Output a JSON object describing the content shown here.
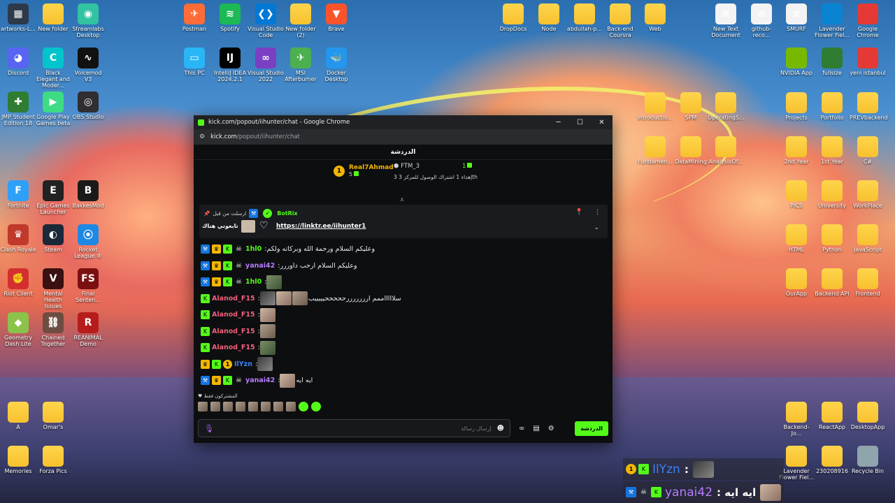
{
  "desktop": {
    "left_icons": [
      {
        "label": "artworks-L...",
        "color": "#2d3a4a",
        "glyph": "▦"
      },
      {
        "label": "New folder",
        "color": "folder",
        "glyph": ""
      },
      {
        "label": "Streamlabs Desktop",
        "color": "#31c3a2",
        "glyph": "◉"
      },
      {
        "label": "Discord",
        "color": "#5865f2",
        "glyph": "◕"
      },
      {
        "label": "Black Elegant and Moder...",
        "color": "#00c4cc",
        "glyph": "C"
      },
      {
        "label": "Voicemod V3",
        "color": "#111111",
        "glyph": "∿"
      },
      {
        "label": "JMP Student Edition 18",
        "color": "#2e7d32",
        "glyph": "✚"
      },
      {
        "label": "Google Play Games beta",
        "color": "#3ddc84",
        "glyph": "▶"
      },
      {
        "label": "OBS Studio",
        "color": "#302e31",
        "glyph": "◎"
      },
      {
        "label": "Fortnite",
        "color": "#2ea0f8",
        "glyph": "F"
      },
      {
        "label": "Epic Games Launcher",
        "color": "#222222",
        "glyph": "E"
      },
      {
        "label": "BakkesMod",
        "color": "#1a1a1a",
        "glyph": "B"
      },
      {
        "label": "Clash Royale",
        "color": "#c0392b",
        "glyph": "♛"
      },
      {
        "label": "Steam",
        "color": "#1b2838",
        "glyph": "◐"
      },
      {
        "label": "Rocket League ®",
        "color": "#1e88e5",
        "glyph": "⦿"
      },
      {
        "label": "Riot Client",
        "color": "#d32f2f",
        "glyph": "✊"
      },
      {
        "label": "Mental Health Issues",
        "color": "#3a1010",
        "glyph": "V"
      },
      {
        "label": "Final Senten...",
        "color": "#7a1010",
        "glyph": "FS"
      },
      {
        "label": "Geometry Dash Lite",
        "color": "#8bc34a",
        "glyph": "◆"
      },
      {
        "label": "Chained Together",
        "color": "#6d4c41",
        "glyph": "⛓"
      },
      {
        "label": "REANIMAL Demo",
        "color": "#b71c1c",
        "glyph": "R"
      },
      {
        "label": "A",
        "color": "folder",
        "glyph": ""
      },
      {
        "label": "Omar's",
        "color": "folder",
        "glyph": ""
      },
      {
        "label": "Memories",
        "color": "folder",
        "glyph": ""
      },
      {
        "label": "Forza Pics",
        "color": "folder",
        "glyph": ""
      }
    ],
    "top_icons": [
      {
        "label": "Postman",
        "color": "#ff6c37",
        "glyph": "✈"
      },
      {
        "label": "Spotify",
        "color": "#1db954",
        "glyph": "≋"
      },
      {
        "label": "Visual Studio Code",
        "color": "#0078d4",
        "glyph": "❮❯"
      },
      {
        "label": "New folder (2)",
        "color": "folder",
        "glyph": ""
      },
      {
        "label": "Brave",
        "color": "#fb542b",
        "glyph": "▼"
      },
      {
        "label": "This PC",
        "color": "#29b6f6",
        "glyph": "▭"
      },
      {
        "label": "IntelliJ IDEA 2024.2.1",
        "color": "#000000",
        "glyph": "IJ"
      },
      {
        "label": "Visual Studio 2022",
        "color": "#7b3fc4",
        "glyph": "∞"
      },
      {
        "label": "MSI Afterburner",
        "color": "#4caf50",
        "glyph": "✈"
      },
      {
        "label": "Docker Desktop",
        "color": "#2496ed",
        "glyph": "🐳"
      }
    ],
    "right_icons": [
      {
        "label": "DropDocs",
        "color": "folder"
      },
      {
        "label": "Node",
        "color": "folder"
      },
      {
        "label": "abdullah-p...",
        "color": "folder"
      },
      {
        "label": "Back-end Coursra",
        "color": "folder"
      },
      {
        "label": "Web",
        "color": "folder"
      },
      {
        "label": "New Text Document",
        "color": "doc"
      },
      {
        "label": "github-reco...",
        "color": "doc"
      },
      {
        "label": "SMURF",
        "color": "doc"
      },
      {
        "label": "Lavender Flower Fiel...",
        "color": "#0a84d0"
      },
      {
        "label": "Google Chrome",
        "color": "#e53935"
      },
      {
        "label": "NVIDIA App",
        "color": "#76b900"
      },
      {
        "label": "fullsize",
        "color": "#2e7d32"
      },
      {
        "label": "yeni istanbul",
        "color": "#e53935"
      },
      {
        "label": "Introductio...",
        "color": "folder"
      },
      {
        "label": "SPM",
        "color": "folder"
      },
      {
        "label": "OperatingS...",
        "color": "folder"
      },
      {
        "label": "Projects",
        "color": "folder"
      },
      {
        "label": "Portfolio",
        "color": "folder"
      },
      {
        "label": "PREVbackend",
        "color": "folder"
      },
      {
        "label": "Fundamen...",
        "color": "folder"
      },
      {
        "label": "DataMining",
        "color": "folder"
      },
      {
        "label": "AnalysisOf...",
        "color": "folder"
      },
      {
        "label": "2nd Year",
        "color": "folder"
      },
      {
        "label": "1st Year",
        "color": "folder"
      },
      {
        "label": "C#",
        "color": "folder"
      },
      {
        "label": "PICS",
        "color": "folder"
      },
      {
        "label": "University",
        "color": "folder"
      },
      {
        "label": "WorkPlace",
        "color": "folder"
      },
      {
        "label": "HTML",
        "color": "folder"
      },
      {
        "label": "Python",
        "color": "folder"
      },
      {
        "label": "JavaScript",
        "color": "folder"
      },
      {
        "label": "OurApp",
        "color": "folder"
      },
      {
        "label": "Backend API",
        "color": "folder"
      },
      {
        "label": "Frontend",
        "color": "folder"
      },
      {
        "label": "Backend-Jo...",
        "color": "folder"
      },
      {
        "label": "ReactApp",
        "color": "folder"
      },
      {
        "label": "DesktopApp",
        "color": "folder"
      },
      {
        "label": "Lavender Flower Fiel...",
        "color": "folder"
      },
      {
        "label": "230208916",
        "color": "folder"
      },
      {
        "label": "Recycle Bin",
        "color": "#90a4ae"
      }
    ]
  },
  "window": {
    "title": "kick.com/popout/iihunter/chat - Google Chrome",
    "url_host": "kick.com",
    "url_path": "/popout/iihunter/chat",
    "minimize": "─",
    "maximize": "☐",
    "close": "✕"
  },
  "chat": {
    "header": "الدردشة",
    "leaderboard": {
      "first_name": "Real7Ahmad",
      "first_count": "5",
      "first_rank": "1",
      "second_name": "FTM_3",
      "second_note": "3 إهداء 1 اشتراك الوصول للمركز 3th",
      "third_count": "1"
    },
    "pinned": {
      "sent_by": "ارسلت من قبل",
      "bot_name": "BotRix",
      "link": "https://linktr.ee/iihunter1",
      "caption": "تابعوني هناك"
    },
    "messages": [
      {
        "user": "1hl0",
        "user_color": "#53fc18",
        "badges": [
          "mod",
          "crown",
          "kick",
          "skull"
        ],
        "text": "وعليكم السلام ورحمة الله وبركاته ولكم",
        "emotes": 0
      },
      {
        "user": "yanai42",
        "user_color": "#b67cff",
        "badges": [
          "mod",
          "crown",
          "kick",
          "skull"
        ],
        "text": "وعليكم السلام ارحب داوررر",
        "emotes": 0
      },
      {
        "user": "1hl0",
        "user_color": "#53fc18",
        "badges": [
          "mod",
          "crown",
          "kick",
          "skull"
        ],
        "text": "",
        "emotes": 1
      },
      {
        "user": "Alanod_F15",
        "user_color": "#f0607a",
        "badges": [
          "kick"
        ],
        "text": "سلاااااممم ارررررررحححححيييييب",
        "emotes": 3
      },
      {
        "user": "Alanod_F15",
        "user_color": "#f0607a",
        "badges": [
          "kick"
        ],
        "text": "",
        "emotes": 1
      },
      {
        "user": "Alanod_F15",
        "user_color": "#f0607a",
        "badges": [
          "kick"
        ],
        "text": "",
        "emotes": 1
      },
      {
        "user": "Alanod_F15",
        "user_color": "#f0607a",
        "badges": [
          "kick"
        ],
        "text": "",
        "emotes": 1
      },
      {
        "user": "IlYzn",
        "user_color": "#3b82f6",
        "badges": [
          "crown",
          "kick",
          "gold"
        ],
        "text": "",
        "emotes": 1
      },
      {
        "user": "yanai42",
        "user_color": "#b67cff",
        "badges": [
          "mod",
          "crown",
          "kick",
          "skull"
        ],
        "text": "ايه ايه",
        "emotes": 1
      }
    ],
    "subscribers_only": "المشتركون فقط",
    "input_placeholder": "إرسال رسالة",
    "send_label": "الدردشة"
  },
  "overlay": [
    {
      "name": "IlYzn",
      "color": "#3b82f6",
      "text": ":"
    },
    {
      "name": "yanai42",
      "color": "#b67cff",
      "text": ": ايه ايه"
    }
  ]
}
